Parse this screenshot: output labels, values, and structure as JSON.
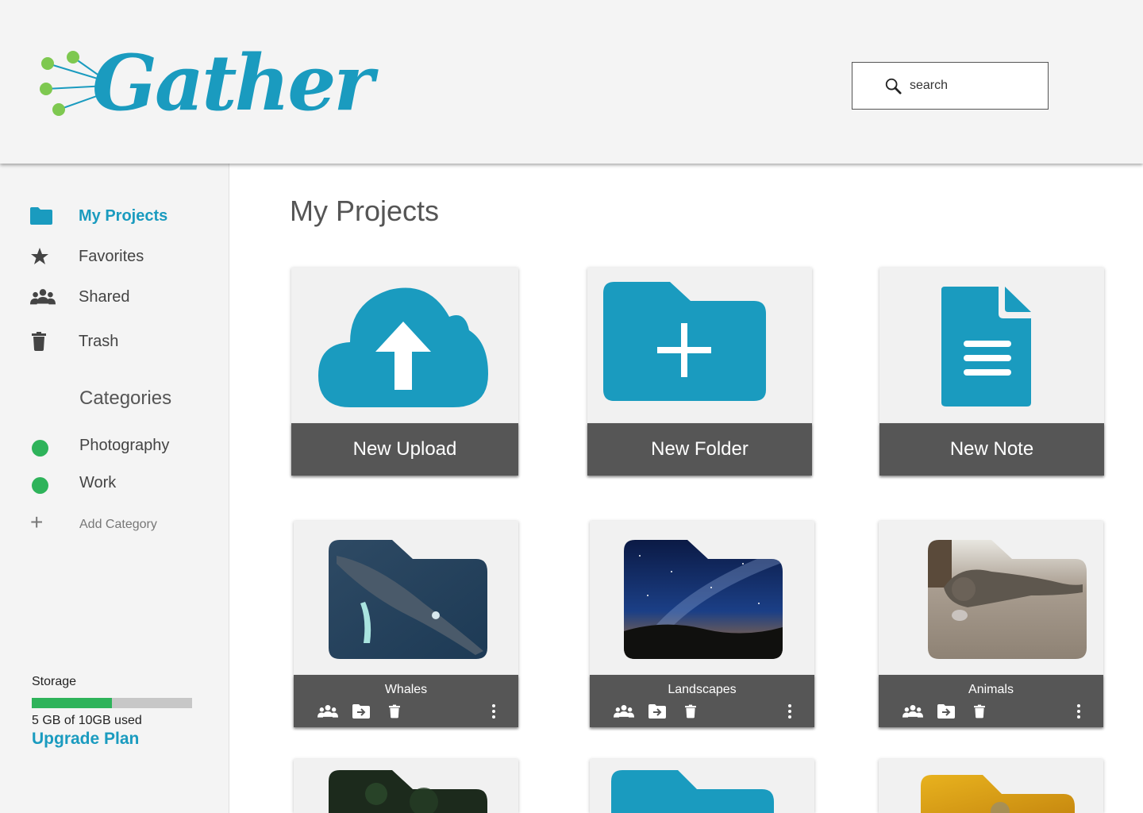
{
  "app": {
    "logo_text": "Gather",
    "brand_color": "#1a9bbf",
    "accent_green": "#2eb35a"
  },
  "search": {
    "placeholder": "search"
  },
  "sidebar": {
    "items": [
      {
        "label": "My Projects",
        "icon": "folder-icon",
        "active": true
      },
      {
        "label": "Favorites",
        "icon": "star-icon",
        "active": false
      },
      {
        "label": "Shared",
        "icon": "users-icon",
        "active": false
      },
      {
        "label": "Trash",
        "icon": "trash-icon",
        "active": false
      }
    ],
    "categories_title": "Categories",
    "categories": [
      {
        "label": "Photography",
        "color": "#2eb35a"
      },
      {
        "label": "Work",
        "color": "#2eb35a"
      }
    ],
    "add_category_label": "Add Category",
    "storage": {
      "label": "Storage",
      "used_text": "5 GB of 10GB used",
      "used_fraction": 0.5,
      "upgrade_label": "Upgrade Plan"
    }
  },
  "main": {
    "title": "My Projects",
    "actions": [
      {
        "label": "New Upload",
        "icon": "cloud-upload-icon"
      },
      {
        "label": "New Folder",
        "icon": "folder-add-icon"
      },
      {
        "label": "New Note",
        "icon": "document-icon"
      }
    ],
    "folders": [
      {
        "name": "Whales",
        "thumbnail": "whale-photo"
      },
      {
        "name": "Landscapes",
        "thumbnail": "night-sky-photo"
      },
      {
        "name": "Animals",
        "thumbnail": "cat-photo"
      }
    ],
    "folder_actions": [
      "share-icon",
      "move-icon",
      "trash-icon",
      "more-icon"
    ]
  }
}
